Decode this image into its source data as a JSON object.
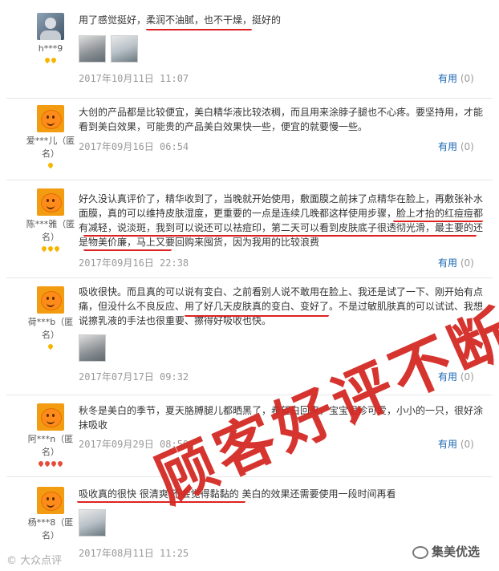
{
  "reviews": [
    {
      "username": "h***9",
      "avatar": "photo",
      "level": "gold",
      "stars": 2,
      "text": "用了感觉挺好，柔润不油腻，也不干燥，挺好的",
      "date": "2017年10月11日 11:07",
      "useful": "有用",
      "count": "(0)",
      "images": 2
    },
    {
      "username": "爱***儿（匿名）",
      "avatar": "orange",
      "level": "gold",
      "stars": 1,
      "text": "大创的产品都是比较便宜，美白精华液比较浓稠，而且用来涂脖子腿也不心疼。要坚持用，才能看到美白效果，可能贵的产品美白效果快一些，便宜的就要慢一些。",
      "date": "2017年09月16日 06:54",
      "useful": "有用",
      "count": "(0)",
      "images": 0
    },
    {
      "username": "陈***雅（匿名）",
      "avatar": "orange",
      "level": "gold",
      "stars": 3,
      "text": "好久没认真评价了，精华收到了，当晚就开始使用，敷面膜之前抹了点精华在脸上，再敷张补水面膜，真的可以维持皮肤湿度，更重要的一点是连续几晚都这样使用步骤，脸上才抬的红痘痘都有减轻，说淡斑，我到可以说还可以祛痘印，第二天可以看到皮肤底子很透彻光滑，最主要的还是物美价廉，马上又要回购来囤货，因为我用的比较浪费",
      "date": "2017年09月16日 22:38",
      "useful": "有用",
      "count": "(0)",
      "images": 0
    },
    {
      "username": "荷***b（匿名）",
      "avatar": "orange",
      "level": "gold",
      "stars": 1,
      "text": "吸收很快。而且真的可以说有变白、之前看别人说不敢用在脸上、我还是试了一下、刚开始有点痛，但没什么不良反应、用了好几天皮肤真的变白、变好了。不是过敏肌肤真的可以试试、我想说擦乳液的手法也很重要、擦得好吸收也快。",
      "date": "2017年07月17日 09:32",
      "useful": "有用",
      "count": "(0)",
      "images": 1
    },
    {
      "username": "阿***n（匿名）",
      "avatar": "orange",
      "level": "red",
      "stars": 4,
      "text": "秋冬是美白的季节，夏天胳膊腿儿都晒黑了，希望白回来，宝宝很珍可爱，小小的一只，很好涂抹吸收",
      "date": "2017年09月29日 08:50",
      "useful": "有用",
      "count": "(0)",
      "images": 0
    },
    {
      "username": "杨***8（匿名）",
      "avatar": "orange",
      "level": "none",
      "stars": 0,
      "text": "吸收真的很快 很清爽 不会觉得黏黏的 美白的效果还需要使用一段时间再看",
      "date": "2017年08月11日 11:25",
      "useful": "有用",
      "count": "(0)",
      "images": 1
    }
  ],
  "stamp_text": "顾客好评不断",
  "watermark_left": "© 大众点评",
  "watermark_right": "集美优选"
}
